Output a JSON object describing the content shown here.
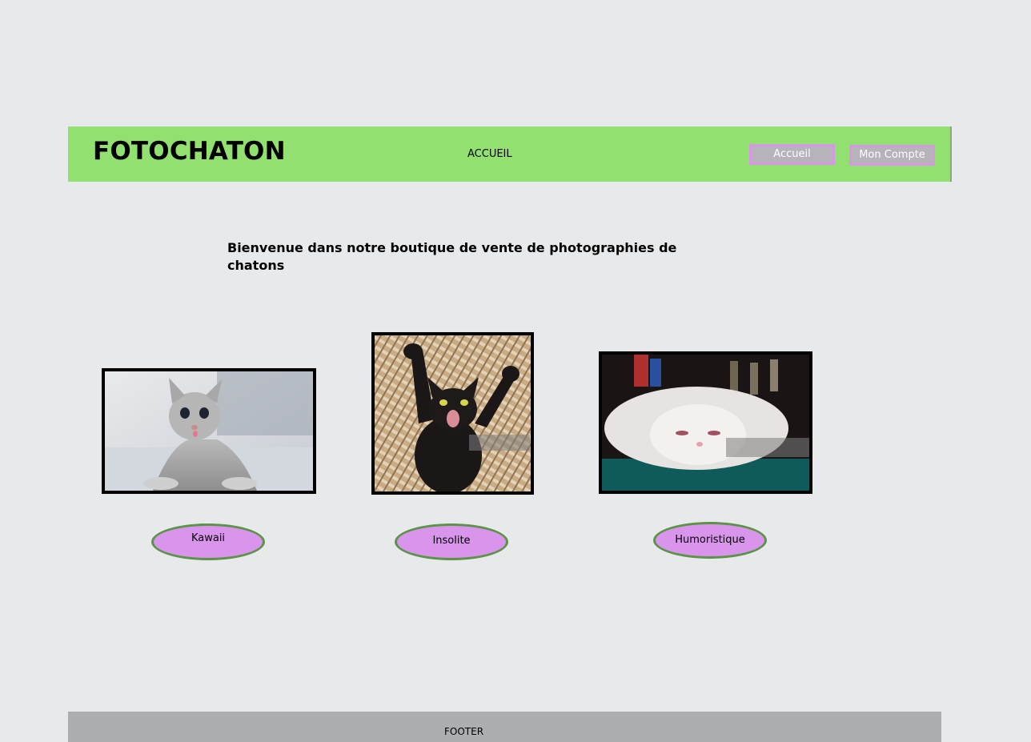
{
  "header": {
    "brand": "FOTOCHATON",
    "nav_link": "ACCUEIL",
    "buttons": {
      "home": "Accueil",
      "account": "Mon Compte"
    }
  },
  "main": {
    "welcome": "Bienvenue dans notre boutique de vente de photographies de chatons",
    "categories": [
      {
        "label": "Kawaii",
        "image": "grey-kitten-photo"
      },
      {
        "label": "Insolite",
        "image": "black-kitten-yawning-photo"
      },
      {
        "label": "Humoristique",
        "image": "fluffy-white-cat-photo"
      }
    ]
  },
  "footer": {
    "text": "FOOTER"
  },
  "colors": {
    "header_bg": "#92e06f",
    "button_bg": "#d994ec",
    "button_border": "#5b9447",
    "footer_bg": "#adaeb1",
    "page_bg": "#e8e9eb"
  }
}
